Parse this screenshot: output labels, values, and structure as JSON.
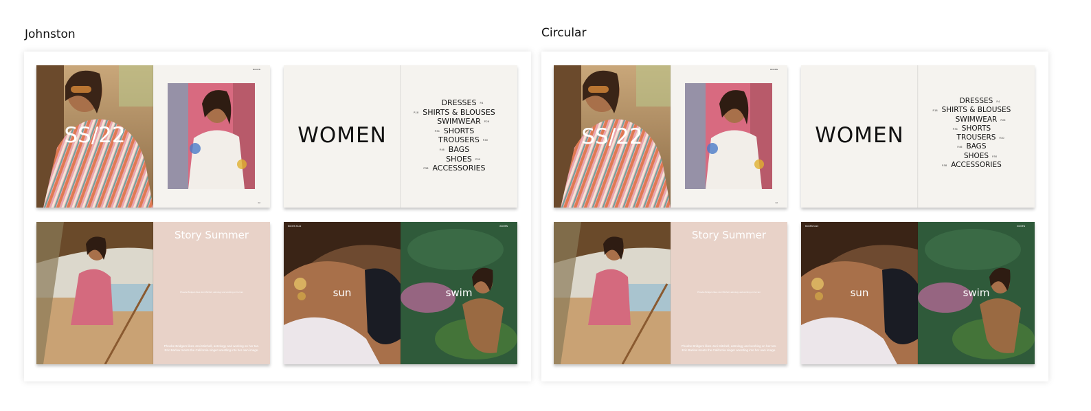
{
  "panels": [
    {
      "title": "Johnston",
      "cover": {
        "headline": "SS/22",
        "brand": "BODEN",
        "page": "02"
      },
      "index": {
        "title": "WOMEN",
        "items": [
          {
            "label": "DRESSES",
            "page": "P.4",
            "side": "right"
          },
          {
            "label": "SHIRTS & BLOUSES",
            "page": "P.18",
            "side": "left"
          },
          {
            "label": "SWIMWEAR",
            "page": "P.26",
            "side": "right"
          },
          {
            "label": "SHORTS",
            "page": "P.34",
            "side": "left"
          },
          {
            "label": "TROUSERS",
            "page": "P.40",
            "side": "right"
          },
          {
            "label": "BAGS",
            "page": "P.46",
            "side": "left"
          },
          {
            "label": "SHOES",
            "page": "P.50",
            "side": "right"
          },
          {
            "label": "ACCESSORIES",
            "page": "P.58",
            "side": "left"
          }
        ]
      },
      "story": {
        "title": "Story Summer",
        "caption": "Phoebe Bridgers likes Joni Mitchell, astrology and working on her tan",
        "body": "Phoebe Bridgers likes Joni Mitchell, astrology and working on her tan. Eric Barlow meets the California singer wrestling into her own image."
      },
      "sunswim": {
        "left_word": "sun",
        "right_word": "swim",
        "left_tag": "BODEN SS22",
        "right_tag": "WOMEN"
      }
    },
    {
      "title": "Circular",
      "cover": {
        "headline": "SS/22",
        "brand": "BODEN",
        "page": "02"
      },
      "index": {
        "title": "WOMEN",
        "items": [
          {
            "label": "DRESSES",
            "page": "P.4",
            "side": "right"
          },
          {
            "label": "SHIRTS & BLOUSES",
            "page": "P.18",
            "side": "left"
          },
          {
            "label": "SWIMWEAR",
            "page": "P.26",
            "side": "right"
          },
          {
            "label": "SHORTS",
            "page": "P.34",
            "side": "left"
          },
          {
            "label": "TROUSERS",
            "page": "P.40",
            "side": "right"
          },
          {
            "label": "BAGS",
            "page": "P.46",
            "side": "left"
          },
          {
            "label": "SHOES",
            "page": "P.50",
            "side": "right"
          },
          {
            "label": "ACCESSORIES",
            "page": "P.58",
            "side": "left"
          }
        ]
      },
      "story": {
        "title": "Story Summer",
        "caption": "Phoebe Bridgers likes Joni Mitchell, astrology and working on her tan",
        "body": "Phoebe Bridgers likes Joni Mitchell, astrology and working on her tan. Eric Barlow meets the California singer wrestling into her own image."
      },
      "sunswim": {
        "left_word": "sun",
        "right_word": "swim",
        "left_tag": "BODEN SS22",
        "right_tag": "WOMEN"
      }
    }
  ]
}
